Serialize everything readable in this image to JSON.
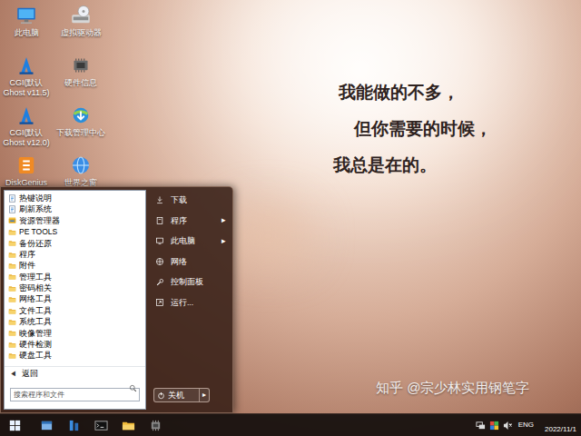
{
  "wallpaper": {
    "quote": [
      "我能做的不多，",
      "但你需要的时候，",
      "我总是在的。"
    ]
  },
  "desktop": {
    "icons": [
      {
        "label": "此电脑",
        "kind": "computer"
      },
      {
        "label": "虚拟驱动器",
        "kind": "virtual-drive"
      },
      {
        "label": "CGI(默认 Ghost v11.5)",
        "kind": "cgi"
      },
      {
        "label": "硬件信息",
        "kind": "hardware"
      },
      {
        "label": "CGI(默认 Ghost v12.0)",
        "kind": "cgi"
      },
      {
        "label": "下载管理中心",
        "kind": "download"
      },
      {
        "label": "DiskGenius",
        "kind": "diskgenius"
      },
      {
        "label": "世界之窗",
        "kind": "browser"
      }
    ]
  },
  "start_menu": {
    "programs": [
      {
        "label": "热键说明",
        "kind": "doc"
      },
      {
        "label": "刷新系统",
        "kind": "doc"
      },
      {
        "label": "资源管理器",
        "kind": "explorer"
      },
      {
        "label": "PE TOOLS",
        "kind": "folder"
      },
      {
        "label": "备份还原",
        "kind": "folder"
      },
      {
        "label": "程序",
        "kind": "folder"
      },
      {
        "label": "附件",
        "kind": "folder"
      },
      {
        "label": "管理工具",
        "kind": "folder"
      },
      {
        "label": "密码相关",
        "kind": "folder"
      },
      {
        "label": "网络工具",
        "kind": "folder"
      },
      {
        "label": "文件工具",
        "kind": "folder"
      },
      {
        "label": "系统工具",
        "kind": "folder"
      },
      {
        "label": "映像管理",
        "kind": "folder"
      },
      {
        "label": "硬件检测",
        "kind": "folder"
      },
      {
        "label": "硬盘工具",
        "kind": "folder"
      }
    ],
    "back": {
      "icon": "◀",
      "label": "返回"
    },
    "search": {
      "placeholder": "搜索程序和文件"
    },
    "places": [
      {
        "label": "下载",
        "kind": "download"
      },
      {
        "label": "程序",
        "kind": "programs",
        "arrow": "▸"
      },
      {
        "label": "此电脑",
        "kind": "computer",
        "arrow": "▸"
      },
      {
        "label": "网络",
        "kind": "network"
      },
      {
        "label": "控制面板",
        "kind": "control-panel"
      },
      {
        "label": "运行...",
        "kind": "run"
      }
    ],
    "shutdown": {
      "label": "关机",
      "arrow": "▸"
    }
  },
  "taskbar": {
    "apps": [
      {
        "kind": "explorer"
      },
      {
        "kind": "tool"
      },
      {
        "kind": "cmd"
      },
      {
        "kind": "folder"
      },
      {
        "kind": "hardware"
      }
    ],
    "tray": {
      "icons": [
        {
          "kind": "network"
        },
        {
          "kind": "display"
        },
        {
          "kind": "volume",
          "muted": true
        }
      ],
      "language": "ENG",
      "date": "2022/11/1"
    }
  },
  "watermark": "知乎 @宗少林实用钢笔字"
}
